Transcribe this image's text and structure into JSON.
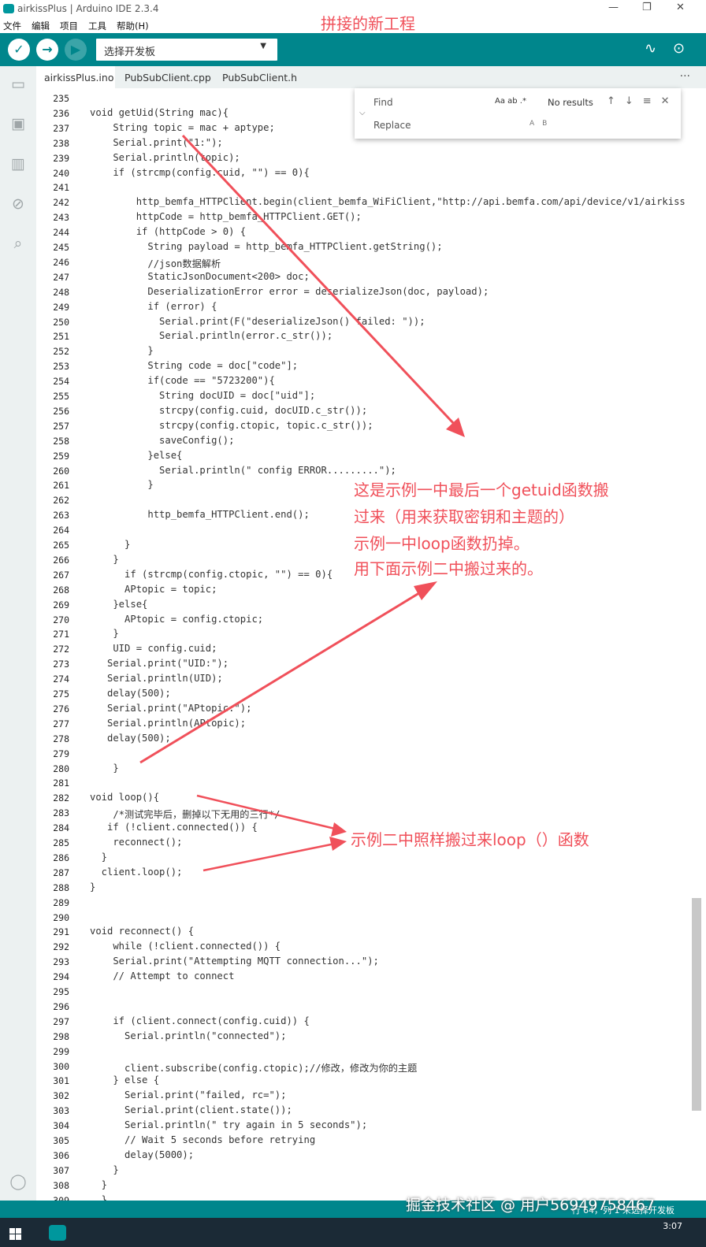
{
  "window": {
    "title": "airkissPlus | Arduino IDE 2.3.4",
    "controls": [
      "—",
      "❐",
      "✕"
    ]
  },
  "menu": [
    "文件",
    "编辑",
    "项目",
    "工具",
    "帮助(H)"
  ],
  "toolbar": {
    "board_select": "选择开发板",
    "verify": "✓",
    "upload": "→",
    "debug": "▶"
  },
  "tabs": [
    "airkissPlus.ino",
    "PubSubClient.cpp",
    "PubSubClient.h"
  ],
  "tabs_more": "···",
  "find_widget": {
    "find_placeholder": "Find",
    "replace_placeholder": "Replace",
    "options": "Aa  ab  .*",
    "results": "No results",
    "nav": "↑↓≡✕",
    "replace_opts": "AB"
  },
  "code_lines": [
    {
      "n": "235",
      "t": ""
    },
    {
      "n": "236",
      "t": "void getUid(String mac){"
    },
    {
      "n": "237",
      "t": "    String topic = mac + aptype;"
    },
    {
      "n": "238",
      "t": "    Serial.print(\"1:\");"
    },
    {
      "n": "239",
      "t": "    Serial.println(topic);"
    },
    {
      "n": "240",
      "t": "    if (strcmp(config.cuid, \"\") == 0){"
    },
    {
      "n": "241",
      "t": ""
    },
    {
      "n": "242",
      "t": "        http_bemfa_HTTPClient.begin(client_bemfa_WiFiClient,\"http://api.bemfa.com/api/device/v1/airkiss"
    },
    {
      "n": "243",
      "t": "        httpCode = http_bemfa_HTTPClient.GET();"
    },
    {
      "n": "244",
      "t": "        if (httpCode > 0) {"
    },
    {
      "n": "245",
      "t": "          String payload = http_bemfa_HTTPClient.getString();"
    },
    {
      "n": "246",
      "t": "          //json数据解析"
    },
    {
      "n": "247",
      "t": "          StaticJsonDocument<200> doc;"
    },
    {
      "n": "248",
      "t": "          DeserializationError error = deserializeJson(doc, payload);"
    },
    {
      "n": "249",
      "t": "          if (error) {"
    },
    {
      "n": "250",
      "t": "            Serial.print(F(\"deserializeJson() failed: \"));"
    },
    {
      "n": "251",
      "t": "            Serial.println(error.c_str());"
    },
    {
      "n": "252",
      "t": "          }"
    },
    {
      "n": "253",
      "t": "          String code = doc[\"code\"];"
    },
    {
      "n": "254",
      "t": "          if(code == \"5723200\"){"
    },
    {
      "n": "255",
      "t": "            String docUID = doc[\"uid\"];"
    },
    {
      "n": "256",
      "t": "            strcpy(config.cuid, docUID.c_str());"
    },
    {
      "n": "257",
      "t": "            strcpy(config.ctopic, topic.c_str());"
    },
    {
      "n": "258",
      "t": "            saveConfig();"
    },
    {
      "n": "259",
      "t": "          }else{"
    },
    {
      "n": "260",
      "t": "            Serial.println(\" config ERROR.........\");"
    },
    {
      "n": "261",
      "t": "          }"
    },
    {
      "n": "262",
      "t": ""
    },
    {
      "n": "263",
      "t": "          http_bemfa_HTTPClient.end();"
    },
    {
      "n": "264",
      "t": ""
    },
    {
      "n": "265",
      "t": "      }"
    },
    {
      "n": "266",
      "t": "    }"
    },
    {
      "n": "267",
      "t": "      if (strcmp(config.ctopic, \"\") == 0){"
    },
    {
      "n": "268",
      "t": "      APtopic = topic;"
    },
    {
      "n": "269",
      "t": "    }else{"
    },
    {
      "n": "270",
      "t": "      APtopic = config.ctopic;"
    },
    {
      "n": "271",
      "t": "    }"
    },
    {
      "n": "272",
      "t": "    UID = config.cuid;"
    },
    {
      "n": "273",
      "t": "   Serial.print(\"UID:\");"
    },
    {
      "n": "274",
      "t": "   Serial.println(UID);"
    },
    {
      "n": "275",
      "t": "   delay(500);"
    },
    {
      "n": "276",
      "t": "   Serial.print(\"APtopic:\");"
    },
    {
      "n": "277",
      "t": "   Serial.println(APtopic);"
    },
    {
      "n": "278",
      "t": "   delay(500);"
    },
    {
      "n": "279",
      "t": ""
    },
    {
      "n": "280",
      "t": "    }"
    },
    {
      "n": "281",
      "t": ""
    },
    {
      "n": "282",
      "t": "void loop(){"
    },
    {
      "n": "283",
      "t": "    /*测试完毕后，删掉以下无用的三行*/"
    },
    {
      "n": "284",
      "t": "   if (!client.connected()) {"
    },
    {
      "n": "285",
      "t": "    reconnect();"
    },
    {
      "n": "286",
      "t": "  }"
    },
    {
      "n": "287",
      "t": "  client.loop();"
    },
    {
      "n": "288",
      "t": "}"
    },
    {
      "n": "289",
      "t": ""
    },
    {
      "n": "290",
      "t": ""
    },
    {
      "n": "291",
      "t": "void reconnect() {"
    },
    {
      "n": "292",
      "t": "    while (!client.connected()) {"
    },
    {
      "n": "293",
      "t": "    Serial.print(\"Attempting MQTT connection...\");"
    },
    {
      "n": "294",
      "t": "    // Attempt to connect"
    },
    {
      "n": "295",
      "t": ""
    },
    {
      "n": "296",
      "t": ""
    },
    {
      "n": "297",
      "t": "    if (client.connect(config.cuid)) {"
    },
    {
      "n": "298",
      "t": "      Serial.println(\"connected\");"
    },
    {
      "n": "299",
      "t": ""
    },
    {
      "n": "300",
      "t": "      client.subscribe(config.ctopic);//修改，修改为你的主题"
    },
    {
      "n": "301",
      "t": "    } else {"
    },
    {
      "n": "302",
      "t": "      Serial.print(\"failed, rc=\");"
    },
    {
      "n": "303",
      "t": "      Serial.print(client.state());"
    },
    {
      "n": "304",
      "t": "      Serial.println(\" try again in 5 seconds\");"
    },
    {
      "n": "305",
      "t": "      // Wait 5 seconds before retrying"
    },
    {
      "n": "306",
      "t": "      delay(5000);"
    },
    {
      "n": "307",
      "t": "    }"
    },
    {
      "n": "308",
      "t": "  }"
    },
    {
      "n": "309",
      "t": "  }"
    }
  ],
  "annotations": {
    "title": "拼接的新工程",
    "getuid_1": "这是示例一中最后一个getuid函数搬",
    "getuid_2": "过来（用来获取密钥和主题的）",
    "getuid_3": "示例一中loop函数扔掉。",
    "getuid_4": "用下面示例二中搬过来的。",
    "loop": "示例二中照样搬过来loop（）函数"
  },
  "statusbar": {
    "right": "行 64，列 1   未选择开发板"
  },
  "watermark": "掘金技术社区 @ 用户56949758467",
  "taskbar": {
    "clock": "3:07"
  },
  "colors": {
    "teal": "#00868c",
    "annotation": "#f0505a",
    "keyword": "#00979d"
  }
}
